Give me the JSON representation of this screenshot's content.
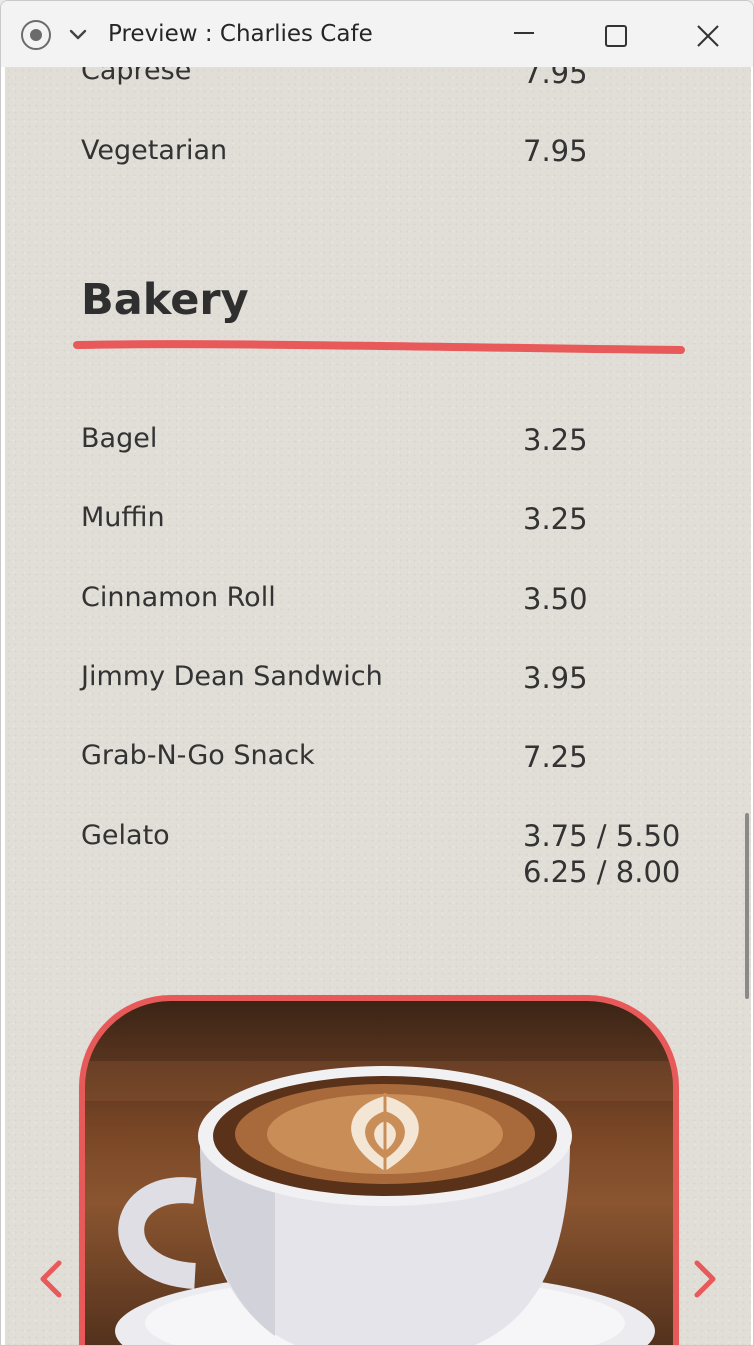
{
  "window": {
    "title": "Preview : Charlies Cafe",
    "icons": [
      "record-icon",
      "chevron-down-icon",
      "minimize-icon",
      "maximize-icon",
      "close-icon"
    ]
  },
  "menu": {
    "previous_items": [
      {
        "name": "Caprese",
        "price": "7.95"
      },
      {
        "name": "Vegetarian",
        "price": "7.95"
      }
    ],
    "section": {
      "title": "Bakery",
      "accent_color": "#e85a5a",
      "items": [
        {
          "name": "Bagel",
          "price": "3.25"
        },
        {
          "name": "Muffin",
          "price": "3.25"
        },
        {
          "name": "Cinnamon Roll",
          "price": "3.50"
        },
        {
          "name": "Jimmy Dean Sandwich",
          "price": "3.95"
        },
        {
          "name": "Grab-N-Go Snack",
          "price": "7.25"
        },
        {
          "name": "Gelato",
          "price_line1": "3.75 / 5.50",
          "price_line2": "6.25 / 8.00"
        }
      ]
    }
  },
  "carousel": {
    "image_subject": "latte-art coffee cup",
    "prev_icon": "chevron-left-icon",
    "next_icon": "chevron-right-icon"
  },
  "colors": {
    "background": "#e1ddd7",
    "text": "#333333",
    "accent": "#e85a5a"
  }
}
